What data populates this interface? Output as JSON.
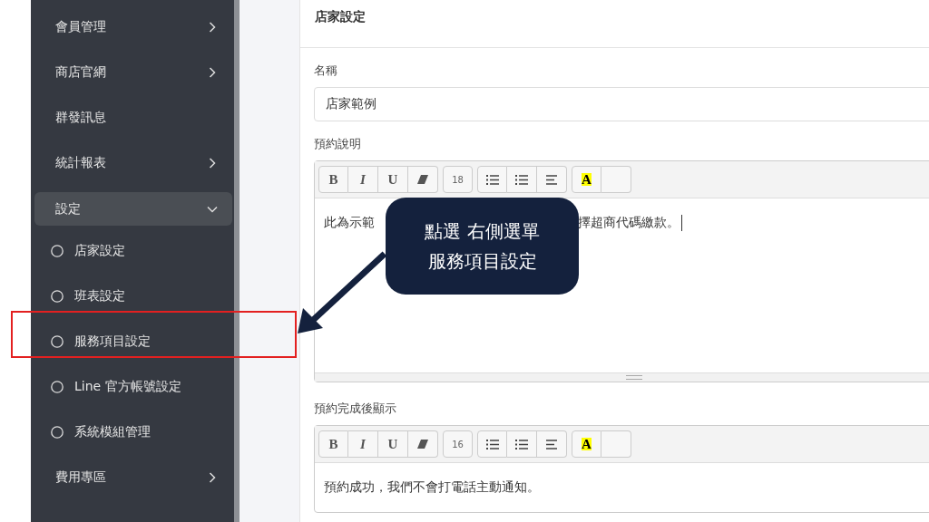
{
  "sidebar": {
    "items": [
      {
        "label": "會員管理",
        "kind": "group",
        "expanded": false
      },
      {
        "label": "商店官網",
        "kind": "group",
        "expanded": false
      },
      {
        "label": "群發訊息",
        "kind": "link"
      },
      {
        "label": "統計報表",
        "kind": "group",
        "expanded": false
      },
      {
        "label": "設定",
        "kind": "group",
        "expanded": true,
        "children": [
          {
            "label": "店家設定"
          },
          {
            "label": "班表設定"
          },
          {
            "label": "服務項目設定"
          },
          {
            "label": "Line 官方帳號設定"
          },
          {
            "label": "系統模組管理"
          }
        ]
      },
      {
        "label": "費用專區",
        "kind": "group",
        "expanded": false
      }
    ]
  },
  "card": {
    "title": "店家設定",
    "fields": [
      {
        "kind": "input",
        "label": "名稱",
        "value": "店家範例"
      },
      {
        "kind": "editor",
        "label": "預約說明",
        "toolbar": [
          [
            {
              "kind": "bold",
              "label": "B"
            },
            {
              "kind": "italic",
              "label": "I"
            },
            {
              "kind": "underline",
              "label": "U"
            },
            {
              "kind": "eraser"
            }
          ],
          [
            {
              "kind": "size",
              "label": "18"
            }
          ],
          [
            {
              "kind": "bullets"
            },
            {
              "kind": "numbers"
            },
            {
              "kind": "align"
            }
          ],
          [
            {
              "kind": "highlight",
              "label": "A"
            },
            {
              "kind": "blank"
            }
          ]
        ],
        "text_before": "此為示範",
        "text_after": "擇超商代碼繳款。",
        "caret": true,
        "resizable": true
      },
      {
        "kind": "editor",
        "label": "預約完成後顯示",
        "toolbar": [
          [
            {
              "kind": "bold",
              "label": "B"
            },
            {
              "kind": "italic",
              "label": "I"
            },
            {
              "kind": "underline",
              "label": "U"
            },
            {
              "kind": "eraser"
            }
          ],
          [
            {
              "kind": "size",
              "label": "16"
            }
          ],
          [
            {
              "kind": "bullets"
            },
            {
              "kind": "numbers"
            },
            {
              "kind": "align"
            }
          ],
          [
            {
              "kind": "highlight",
              "label": "A"
            },
            {
              "kind": "blank"
            }
          ]
        ],
        "text_before": "預約成功，我們不會打電話主動通知。",
        "caret": false,
        "resizable": false
      }
    ]
  },
  "annotation": {
    "lines": [
      "點選 右側選單",
      "服務項目設定"
    ]
  }
}
